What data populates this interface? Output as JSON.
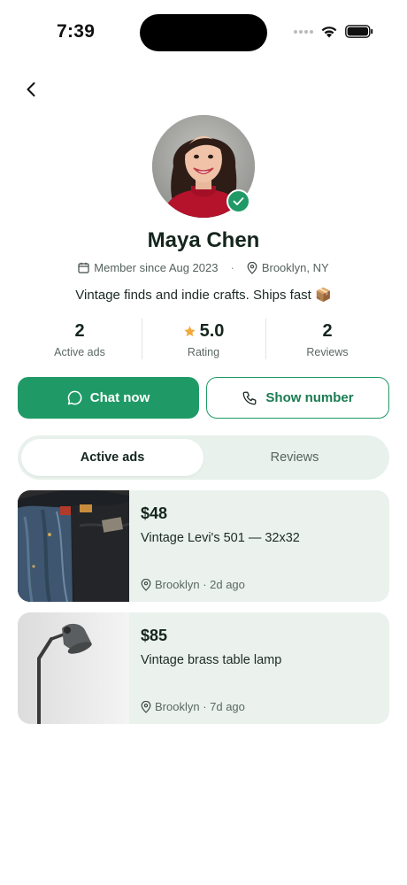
{
  "status_bar": {
    "time": "7:39"
  },
  "profile": {
    "name": "Maya Chen",
    "member_since": "Member since Aug 2023",
    "location": "Brooklyn, NY",
    "meta_separator": "·",
    "bio": "Vintage finds and indie crafts. Ships fast 📦",
    "verified": true
  },
  "stats": [
    {
      "value": "2",
      "label": "Active ads"
    },
    {
      "value": "5.0",
      "label": "Rating",
      "icon": "star-icon"
    },
    {
      "value": "2",
      "label": "Reviews"
    }
  ],
  "actions": {
    "chat_label": "Chat now",
    "phone_label": "Show number"
  },
  "tabs": [
    {
      "label": "Active ads",
      "active": true
    },
    {
      "label": "Reviews",
      "active": false
    }
  ],
  "listings": [
    {
      "price": "$48",
      "title": "Vintage Levi's 501 — 32x32",
      "meta": "Brooklyn · 2d ago",
      "thumb_icon": "jeans-photo"
    },
    {
      "price": "$85",
      "title": "Vintage brass table lamp",
      "meta": "Brooklyn · 7d ago",
      "thumb_icon": "lamp-photo"
    }
  ],
  "colors": {
    "accent": "#1f9a66",
    "accent_dark": "#1a7a52",
    "tab_track": "#e8f1ec",
    "card_bg": "#ebf2ee",
    "star": "#f2a93b"
  }
}
